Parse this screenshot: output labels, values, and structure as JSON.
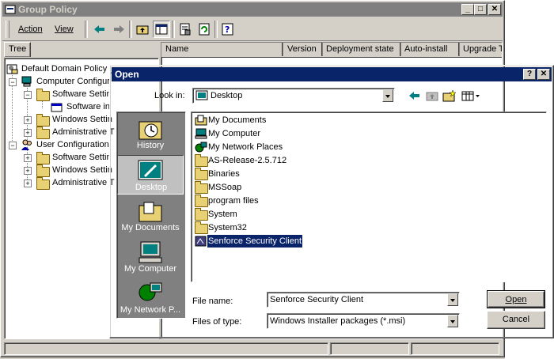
{
  "main_window": {
    "title": "Group Policy",
    "menu": {
      "action": "Action",
      "view": "View"
    },
    "tree_tab": "Tree",
    "columns": [
      "Name",
      "Version",
      "Deployment state",
      "Auto-install",
      "Upgrade T"
    ],
    "tree": {
      "root": "Default Domain Policy [",
      "computer_config": "Computer Configur",
      "software_settings": "Software Settin",
      "software_installation": "Software in",
      "windows_settings": "Windows Settin",
      "admin_templates": "Administrative T",
      "user_config": "User Configuration",
      "user_software_settings": "Software Settin",
      "user_windows_settings": "Windows Settin",
      "user_admin_templates": "Administrative T"
    }
  },
  "open_dialog": {
    "title": "Open",
    "look_in_label": "Look in:",
    "look_in_value": "Desktop",
    "places": [
      "History",
      "Desktop",
      "My Documents",
      "My Computer",
      "My Network P..."
    ],
    "files": [
      {
        "name": "My Documents",
        "icon": "my-documents-icon"
      },
      {
        "name": "My Computer",
        "icon": "computer-icon"
      },
      {
        "name": "My Network Places",
        "icon": "network-icon"
      },
      {
        "name": "AS-Release-2.5.712",
        "icon": "folder-icon"
      },
      {
        "name": "Binaries",
        "icon": "folder-icon"
      },
      {
        "name": "MSSoap",
        "icon": "folder-icon"
      },
      {
        "name": "program files",
        "icon": "folder-icon"
      },
      {
        "name": "System",
        "icon": "folder-icon"
      },
      {
        "name": "System32",
        "icon": "folder-icon"
      },
      {
        "name": "Senforce Security Client",
        "icon": "msi-package-icon",
        "selected": true
      }
    ],
    "file_name_label": "File name:",
    "file_name_value": "Senforce Security Client",
    "files_of_type_label": "Files of type:",
    "files_of_type_value": "Windows Installer packages (*.msi)",
    "open_button": "Open",
    "cancel_button": "Cancel",
    "help_button": "?",
    "close_button": "✕"
  },
  "colors": {
    "title_active": "#0a246a",
    "title_inactive": "#808080",
    "face": "#d4d0c8",
    "places_bar": "#808080",
    "selection": "#0a246a"
  }
}
